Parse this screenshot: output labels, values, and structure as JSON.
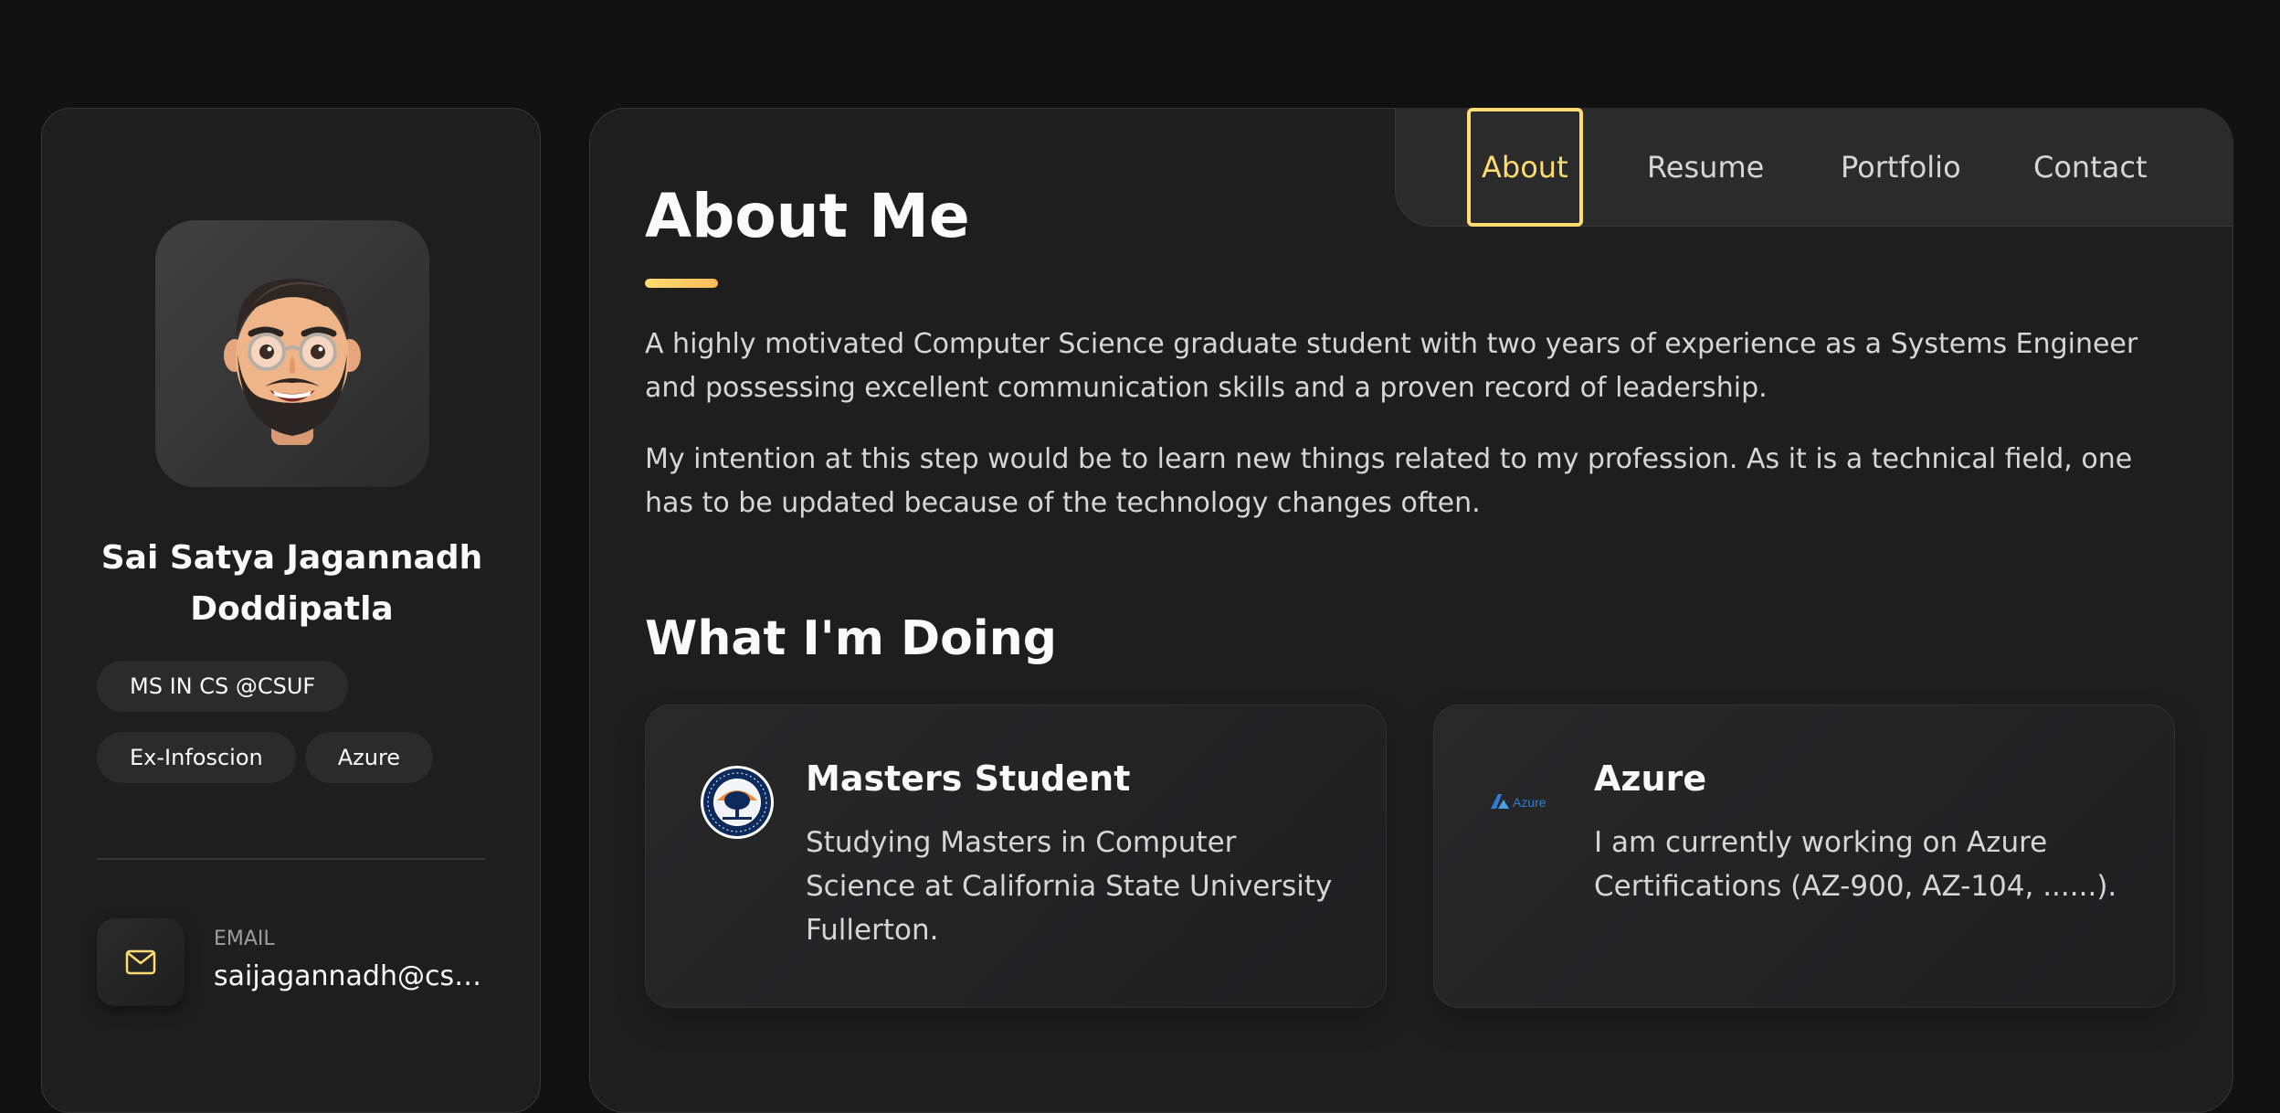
{
  "sidebar": {
    "name_line1": "Sai Satya Jagannadh",
    "name_line2": "Doddipatla",
    "badges": [
      "MS IN CS @CSUF",
      "Ex-Infoscion",
      "Azure"
    ],
    "contacts": [
      {
        "title": "Email",
        "value": "saijagannadh@csu...",
        "icon": "mail-icon"
      }
    ],
    "avatar_icon": "memoji-avatar"
  },
  "navbar": {
    "items": [
      "About",
      "Resume",
      "Portfolio",
      "Contact"
    ],
    "active": "About"
  },
  "about": {
    "title": "About Me",
    "paragraphs": [
      "A highly motivated Computer Science graduate student with two years of experience as a Systems Engineer and possessing excellent communication skills and a proven record of leadership.",
      "My intention at this step would be to learn new things related to my profession. As it is a technical field, one has to be updated because of the technology changes often."
    ]
  },
  "services": {
    "title": "What I'm Doing",
    "items": [
      {
        "title": "Masters Student",
        "text": "Studying Masters in Computer Science at California State University Fullerton.",
        "icon": "csuf-seal-icon"
      },
      {
        "title": "Azure",
        "text": "I am currently working on Azure Certifications (AZ-900, AZ-104, ......).",
        "icon": "azure-logo-icon",
        "logo_text": "Azure"
      }
    ]
  },
  "colors": {
    "accent": "#ffdb70",
    "background": "#121212",
    "card": "#1e1e1f",
    "text": "#fafafa",
    "muted": "#d6d6d6"
  }
}
